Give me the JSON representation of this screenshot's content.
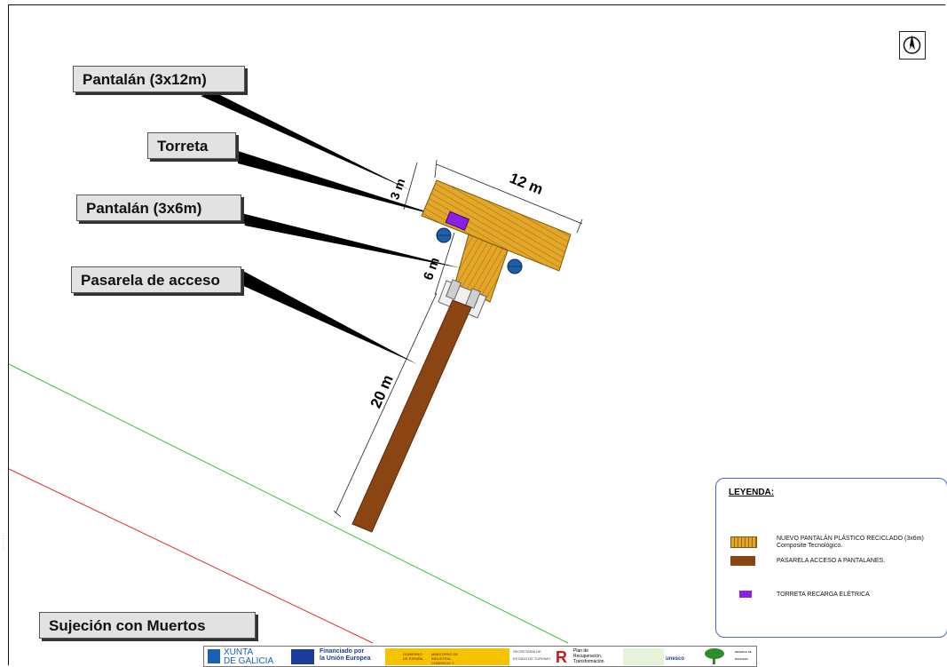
{
  "callouts": {
    "pantalan_12": "Pantalán (3x12m)",
    "torreta": "Torreta",
    "pantalan_6": "Pantalán (3x6m)",
    "pasarela": "Pasarela de acceso",
    "sujecion": "Sujeción con Muertos"
  },
  "dimensions": {
    "d3": "3 m",
    "d12": "12 m",
    "d6": "6 m",
    "d20": "20 m"
  },
  "legend": {
    "title": "LEYENDA:",
    "items": [
      {
        "text": "NUEVO PANTALÁN PLÁSTICO RECICLADO (3x6m) Composite Tecnológico.",
        "color": "#e3a629"
      },
      {
        "text": "PASARELA ACCESO A PANTALANES.",
        "color": "#8b4513"
      },
      {
        "text": "TORRETA RECARGA ELÉTRICA",
        "color": "#8b1fe8"
      }
    ]
  },
  "colors": {
    "deck": "#e3a629",
    "walkway": "#8b4513",
    "tower": "#8b1fe8",
    "buoy": "#1f5fa8",
    "line_green": "#3ec03e",
    "line_red": "#e03030"
  },
  "logos": {
    "xunta_1": "XUNTA",
    "xunta_2": "DE GALICIA",
    "eu_1": "Financiado por",
    "eu_2": "la Unión Europea",
    "gob": "GOBIERNO DE ESPAÑA",
    "min": "MINISTERIO DE INDUSTRIA, COMERCIO Y TURISMO",
    "sec": "SECRETARÍA DE ESTADO DE TURISMO",
    "plan_1": "Plan de",
    "plan_2": "Recuperación,",
    "plan_3": "Transformación",
    "unesco": "unesco",
    "reserva": "RESERVA DE BIOSFERA"
  },
  "icons": {
    "compass": "north-arrow-icon"
  }
}
